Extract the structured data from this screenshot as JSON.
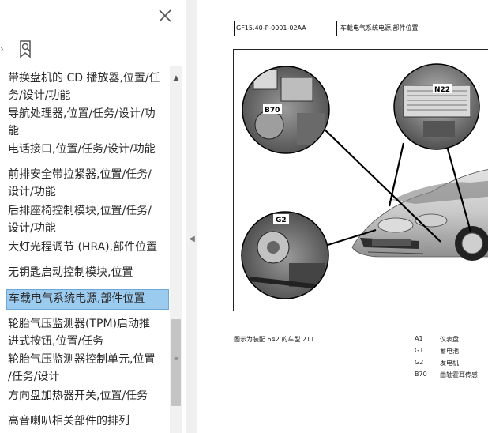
{
  "panel": {
    "close_icon": "close-icon",
    "bookmark_icon": "bookmark-search-icon",
    "items": [
      {
        "line1": "带换盘机的 CD 播放器,位置/任",
        "line2": "务/设计/功能"
      },
      {
        "line1": "导航处理器,位置/任务/设计/功",
        "line2": "能"
      },
      {
        "line1": "电话接口,位置/任务/设计/功能",
        "line2": ""
      },
      {
        "line1": "前排安全带拉紧器,位置/任务/",
        "line2": "设计/功能"
      },
      {
        "line1": "后排座椅控制模块,位置/任务/",
        "line2": "设计/功能"
      },
      {
        "line1": "大灯光程调节 (HRA),部件位置",
        "line2": ""
      },
      {
        "line1": "无钥匙启动控制模块,位置",
        "line2": ""
      },
      {
        "line1": "车载电气系统电源,部件位置",
        "line2": ""
      },
      {
        "line1": "轮胎气压监测器(TPM)启动推",
        "line2": "进式按钮,位置/任务"
      },
      {
        "line1": "轮胎气压监测器控制单元,位置",
        "line2": "/任务/设计"
      },
      {
        "line1": "方向盘加热器开关,位置/任务",
        "line2": ""
      },
      {
        "line1": "高音喇叭相关部件的排列",
        "line2": ""
      }
    ],
    "selected_index": 7
  },
  "document": {
    "doc_id": "GF15.40-P-0001-02AA",
    "doc_title": "车载电气系统电源,部件位置",
    "figure_labels": {
      "b70": "B70",
      "n22": "N22",
      "g2": "G2"
    },
    "caption": "图示为装配 642 的车型 211",
    "legend": [
      {
        "code": "A1",
        "desc": "仪表盘"
      },
      {
        "code": "G1",
        "desc": "蓄电池"
      },
      {
        "code": "G2",
        "desc": "发电机"
      },
      {
        "code": "B70",
        "desc": "曲轴霍耳传感"
      }
    ]
  }
}
